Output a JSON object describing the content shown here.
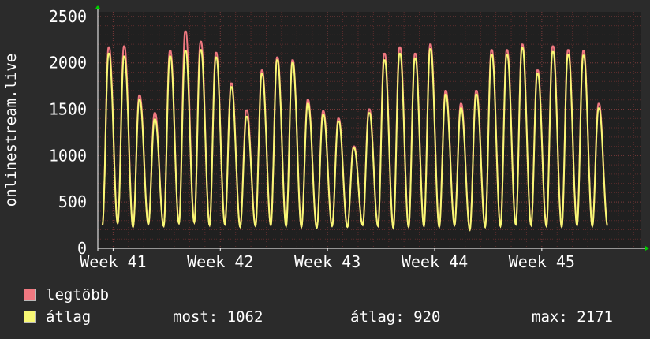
{
  "chart_data": {
    "type": "line",
    "ylabel": "onlinestream.live",
    "yticks": [
      0,
      500,
      1000,
      1500,
      2000,
      2500
    ],
    "ylim": [
      0,
      2550
    ],
    "xticks": [
      "Week 41",
      "Week 42",
      "Week 43",
      "Week 44",
      "Week 45"
    ],
    "x_unit": "day",
    "x_range_days": [
      -1,
      34.5
    ],
    "week_starts_days": [
      0,
      7,
      14,
      21,
      28
    ],
    "grid": true,
    "daily_peaks_max": [
      2170,
      2180,
      1650,
      1460,
      2130,
      2340,
      2230,
      2110,
      1780,
      1490,
      1920,
      2060,
      2030,
      1600,
      1480,
      1400,
      1100,
      1500,
      2100,
      2170,
      2100,
      2200,
      1700,
      1560,
      1700,
      2140,
      2140,
      2200,
      1920,
      2180,
      2140,
      2130,
      1560
    ],
    "daily_peaks_avg": [
      2100,
      2070,
      1600,
      1390,
      2070,
      2130,
      2140,
      2060,
      1740,
      1420,
      1880,
      2030,
      2000,
      1560,
      1440,
      1370,
      1080,
      1460,
      2030,
      2100,
      2050,
      2150,
      1660,
      1510,
      1660,
      2090,
      2090,
      2160,
      1880,
      2120,
      2090,
      2080,
      1510
    ],
    "daily_troughs": [
      250,
      270,
      230,
      260,
      240,
      270,
      280,
      250,
      260,
      230,
      240,
      250,
      240,
      230,
      220,
      240,
      230,
      250,
      240,
      220,
      230,
      240,
      230,
      250,
      200,
      230,
      240,
      260,
      250,
      240,
      230,
      250,
      240
    ],
    "series": [
      {
        "name": "legtöbb",
        "color": "#f07880"
      },
      {
        "name": "átlag",
        "color": "#f8f874"
      }
    ]
  },
  "legend": {
    "max_label": "legtöbb",
    "avg_label": "átlag",
    "max_color": "#f07880",
    "avg_color": "#f8f874",
    "stats": {
      "current": "most: 1062",
      "average": "átlag: 920",
      "maximum": "max: 2171"
    }
  },
  "colors": {
    "background": "#2b2b2b",
    "plot_background": "#202020",
    "grid": "#5a2c2c",
    "axis": "#ffffff",
    "arrow": "#00cc00"
  }
}
